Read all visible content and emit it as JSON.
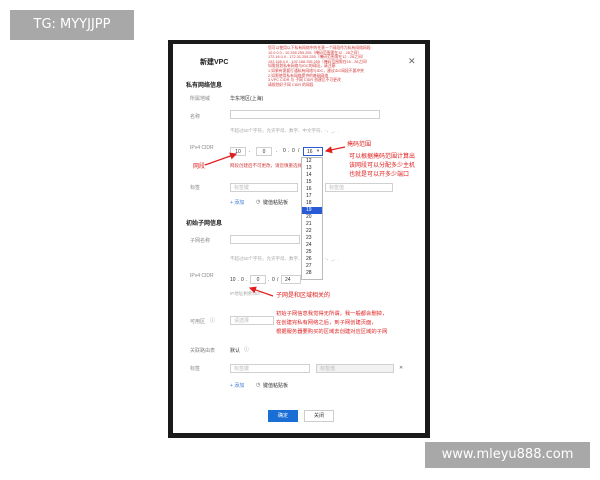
{
  "watermarks": {
    "top_left": "TG: MYYJJPP",
    "bottom_right": "www.mleyu888.com"
  },
  "dialog": {
    "title": "新建VPC",
    "close_glyph": "✕",
    "private_section": "私有网络信息",
    "region_label": "所属地域",
    "region_value": "华东地区(上海)",
    "name_label": "名称",
    "name_hint": "不超过60个字符，允许字母、数字、中文字符、-、_、.",
    "cidr_label": "IPv4 CIDR",
    "cidr": {
      "o1": "10",
      "o2": "0",
      "o3": "0",
      "o4": "0",
      "mask": "16"
    },
    "cidr_note": "网段创建后不可更改，请您慎重选择网段",
    "tag_label": "标签",
    "tag_key_placeholder": "标签键",
    "tag_val_placeholder": "标签值",
    "add_link": "+ 添加",
    "key_value_link": "键值粘贴板",
    "subnet_section": "初始子网信息",
    "subnet_name_label": "子网名称",
    "subnet_name_hint": "不超过60个字符，允许字母、数字、中文字符、-、_、.",
    "subnet_cidr_label": "IPv4 CIDR",
    "subnet_cidr": {
      "o1": "10",
      "o2": "0",
      "o3": "0",
      "o4": "0",
      "mask": "24"
    },
    "ip_count_note": "IP地址剩余253个",
    "az_label": "可用区",
    "az_placeholder": "请选择",
    "route_label": "关联路由表",
    "route_value": "默认",
    "subnet_tag_label": "标签",
    "subnet_tag_key": "标签键",
    "subnet_tag_val": "标签值",
    "subnet_add_link": "+ 添加",
    "subnet_key_value_link": "键值粘贴板",
    "ok_button": "确定",
    "cancel_button": "关闭"
  },
  "red_notes": [
    "您可以使用以下私有网络中的任意一个网段作为私有网络网段:",
    "10.0.0.0 - 10.255.255.255（掩码范围需在12 - 28之间）",
    "172.16.0.0 - 172.31.255.255（掩码范围需在12 - 28之间）",
    "192.168.0.0 - 192.168.255.255（掩码范围需在16 - 28之间）",
    "如需规划私有网络与IDC的网段，请注意:",
    "1.如果有需要打通私有网络与IDC，建议IDC网段不要冲突",
    "2.如需使用私有网络提供的基础网络",
    "3.VPC CIDR 与 子网 CIDR 创建后不可更改",
    "请规划好子网 CIDR 的网段"
  ],
  "mask_options": [
    "12",
    "13",
    "14",
    "15",
    "16",
    "17",
    "18",
    "19",
    "20",
    "21",
    "22",
    "23",
    "24",
    "25",
    "26",
    "27",
    "28"
  ],
  "mask_selected": "19",
  "annotations": {
    "segment": "网段",
    "mask_range": "掩码范围",
    "mask_explain": [
      "可以根据掩码范围计算出",
      "该网段可以分配多少主机",
      "也就是可以开多少端口"
    ],
    "subnet_region": "子网是和区域相关的",
    "subnet_explain": [
      "初始子网信息我觉得无所谓，我一般都会删掉，",
      "在创建完私有网络之后，到子网创建页面，",
      "根据服务器要购买的区域去创建对应区域的子网"
    ]
  },
  "colors": {
    "accent": "#1a6fd6",
    "annotation": "#e02020",
    "selected_option": "#2a5bd7"
  }
}
